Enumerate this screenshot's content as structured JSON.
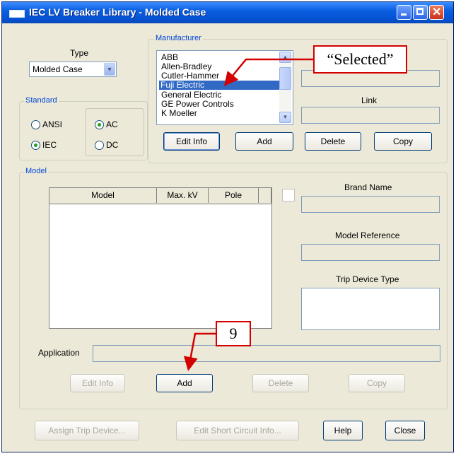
{
  "window": {
    "title": "IEC LV Breaker Library - Molded Case"
  },
  "type_section": {
    "label": "Type",
    "selected": "Molded Case"
  },
  "standard": {
    "label": "Standard",
    "ansi": "ANSI",
    "iec": "IEC",
    "ac": "AC",
    "dc": "DC",
    "selected_standard": "IEC",
    "selected_current": "AC"
  },
  "manufacturer": {
    "label": "Manufacturer",
    "items": [
      "ABB",
      "Allen-Bradley",
      "Cutler-Hammer",
      "Fuji Electric",
      "General Electric",
      "GE Power Controls",
      "K Moeller"
    ],
    "selected": "Fuji Electric",
    "link_label": "Link",
    "edit_info": "Edit Info",
    "add": "Add",
    "delete": "Delete",
    "copy": "Copy"
  },
  "model": {
    "label": "Model",
    "columns": [
      "Model",
      "Max. kV",
      "Pole"
    ],
    "brand_name_label": "Brand Name",
    "model_reference_label": "Model Reference",
    "trip_device_type_label": "Trip Device Type",
    "application_label": "Application",
    "edit_info": "Edit Info",
    "add": "Add",
    "delete": "Delete",
    "copy": "Copy"
  },
  "footer": {
    "assign_trip_device": "Assign Trip Device...",
    "edit_short_circuit": "Edit Short Circuit Info...",
    "help": "Help",
    "close": "Close"
  },
  "annotations": {
    "selected_callout": "“Selected”",
    "step_number": "9",
    "color": "#d40000"
  },
  "colors": {
    "titlebar": "#0551d4",
    "selection": "#316ac5",
    "group_label": "#0046d5",
    "dialog_bg": "#ece9d8"
  },
  "icons": {
    "minimize": "minimize-icon",
    "maximize": "maximize-icon",
    "close": "close-icon"
  }
}
